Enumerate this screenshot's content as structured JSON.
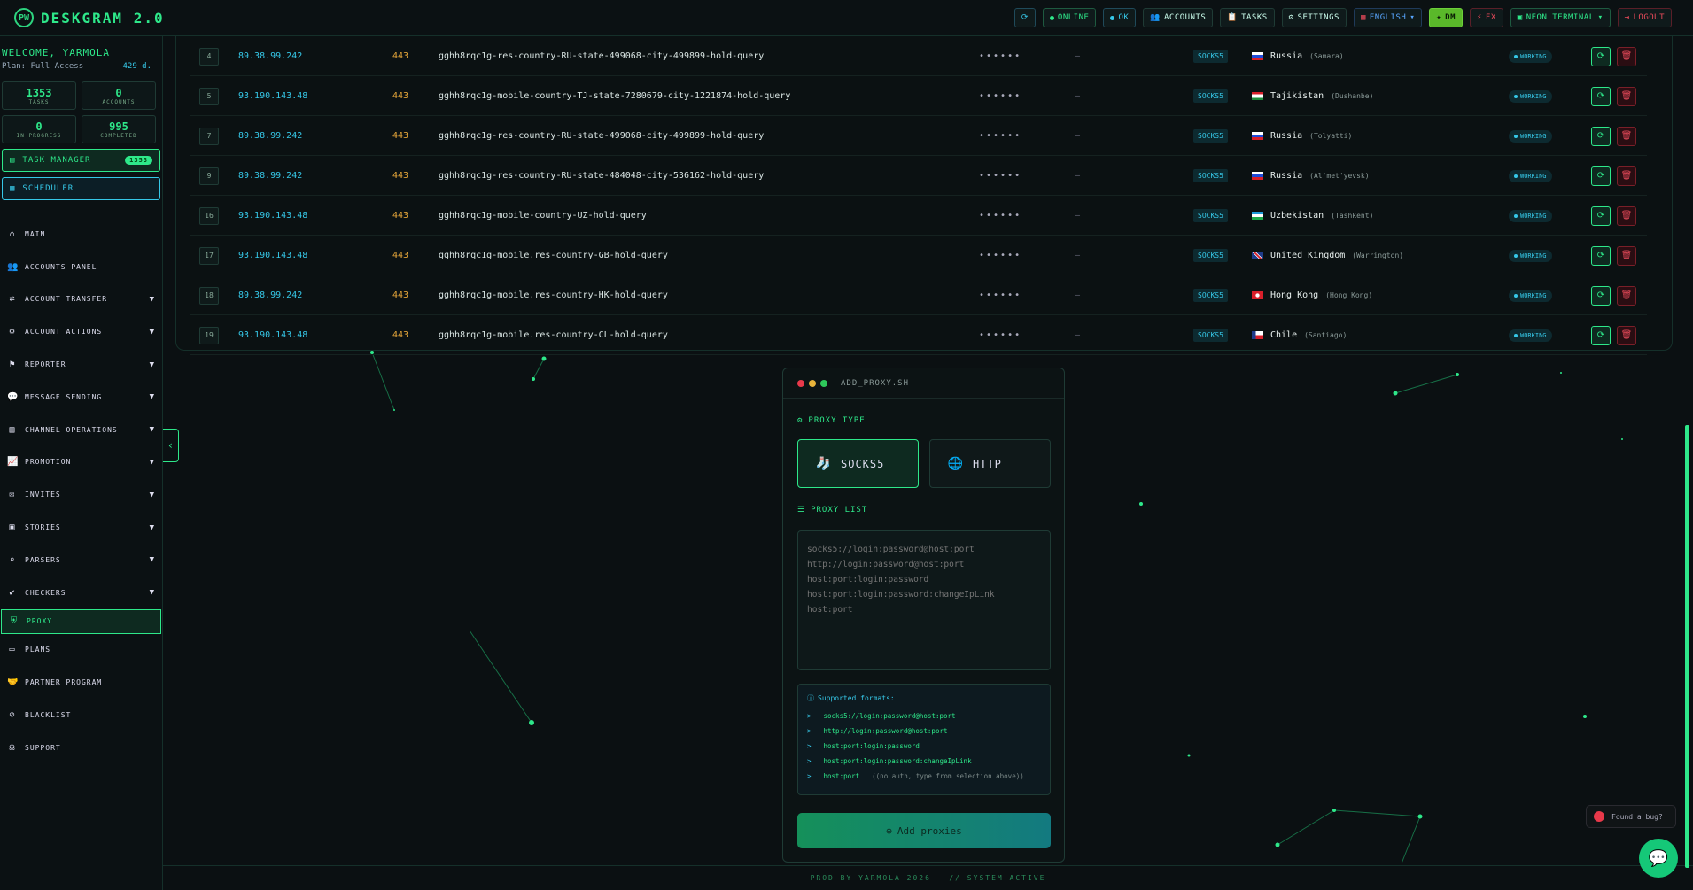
{
  "app": {
    "logo": "PW",
    "name": "DESKGRAM 2.0"
  },
  "topbar": {
    "refresh_icon": "refresh-icon",
    "online": "ONLINE",
    "ok": "OK",
    "accounts": "ACCOUNTS",
    "tasks": "TASKS",
    "settings": "SETTINGS",
    "language": "ENGLISH",
    "dm": "DM",
    "fx": "FX",
    "theme": "NEON TERMINAL",
    "logout": "LOGOUT"
  },
  "sidebar": {
    "welcome": "WELCOME, YARMOLA",
    "plan": "Plan: Full Access",
    "days": "429 d.",
    "stats": [
      {
        "value": "1353",
        "label": "TASKS"
      },
      {
        "value": "0",
        "label": "ACCOUNTS"
      },
      {
        "value": "0",
        "label": "IN PROGRESS"
      },
      {
        "value": "995",
        "label": "COMPLETED"
      }
    ],
    "task_manager": "TASK MANAGER",
    "task_manager_badge": "1353",
    "scheduler": "SCHEDULER",
    "menu": [
      {
        "label": "MAIN",
        "icon": "home-icon",
        "has_chevron": false
      },
      {
        "label": "ACCOUNTS PANEL",
        "icon": "users-icon",
        "has_chevron": false
      },
      {
        "label": "ACCOUNT TRANSFER",
        "icon": "transfer-icon",
        "has_chevron": true
      },
      {
        "label": "ACCOUNT ACTIONS",
        "icon": "user-cog-icon",
        "has_chevron": true
      },
      {
        "label": "REPORTER",
        "icon": "flag-icon",
        "has_chevron": true
      },
      {
        "label": "MESSAGE SENDING",
        "icon": "chat-icon",
        "has_chevron": true
      },
      {
        "label": "CHANNEL OPERATIONS",
        "icon": "channel-icon",
        "has_chevron": true
      },
      {
        "label": "PROMOTION",
        "icon": "chart-icon",
        "has_chevron": true
      },
      {
        "label": "INVITES",
        "icon": "invite-icon",
        "has_chevron": true
      },
      {
        "label": "STORIES",
        "icon": "stories-icon",
        "has_chevron": true
      },
      {
        "label": "PARSERS",
        "icon": "search-icon",
        "has_chevron": true
      },
      {
        "label": "CHECKERS",
        "icon": "check-icon",
        "has_chevron": true
      },
      {
        "label": "PROXY",
        "icon": "shield-icon",
        "has_chevron": false,
        "active": true
      },
      {
        "label": "PLANS",
        "icon": "card-icon",
        "has_chevron": false
      },
      {
        "label": "PARTNER PROGRAM",
        "icon": "partner-icon",
        "has_chevron": false
      },
      {
        "label": "BLACKLIST",
        "icon": "block-user-icon",
        "has_chevron": false
      },
      {
        "label": "SUPPORT",
        "icon": "headset-icon",
        "has_chevron": false
      }
    ]
  },
  "proxies": [
    {
      "id": "4",
      "ip": "89.38.99.242",
      "port": "443",
      "login": "gghh8rqc1g-res-country-RU-state-499068-city-499899-hold-query",
      "password": "••••••",
      "extra": "—",
      "type": "SOCKS5",
      "country": "Russia",
      "city": "(Samara)",
      "flag": "ru",
      "status": "WORKING"
    },
    {
      "id": "5",
      "ip": "93.190.143.48",
      "port": "443",
      "login": "gghh8rqc1g-mobile-country-TJ-state-7280679-city-1221874-hold-query",
      "password": "••••••",
      "extra": "—",
      "type": "SOCKS5",
      "country": "Tajikistan",
      "city": "(Dushanbe)",
      "flag": "tj",
      "status": "WORKING"
    },
    {
      "id": "7",
      "ip": "89.38.99.242",
      "port": "443",
      "login": "gghh8rqc1g-res-country-RU-state-499068-city-499899-hold-query",
      "password": "••••••",
      "extra": "—",
      "type": "SOCKS5",
      "country": "Russia",
      "city": "(Tolyatti)",
      "flag": "ru",
      "status": "WORKING"
    },
    {
      "id": "9",
      "ip": "89.38.99.242",
      "port": "443",
      "login": "gghh8rqc1g-res-country-RU-state-484048-city-536162-hold-query",
      "password": "••••••",
      "extra": "—",
      "type": "SOCKS5",
      "country": "Russia",
      "city": "(Al'met'yevsk)",
      "flag": "ru",
      "status": "WORKING"
    },
    {
      "id": "16",
      "ip": "93.190.143.48",
      "port": "443",
      "login": "gghh8rqc1g-mobile-country-UZ-hold-query",
      "password": "••••••",
      "extra": "—",
      "type": "SOCKS5",
      "country": "Uzbekistan",
      "city": "(Tashkent)",
      "flag": "uz",
      "status": "WORKING"
    },
    {
      "id": "17",
      "ip": "93.190.143.48",
      "port": "443",
      "login": "gghh8rqc1g-mobile.res-country-GB-hold-query",
      "password": "••••••",
      "extra": "—",
      "type": "SOCKS5",
      "country": "United Kingdom",
      "city": "(Warrington)",
      "flag": "gb",
      "status": "WORKING"
    },
    {
      "id": "18",
      "ip": "89.38.99.242",
      "port": "443",
      "login": "gghh8rqc1g-mobile.res-country-HK-hold-query",
      "password": "••••••",
      "extra": "—",
      "type": "SOCKS5",
      "country": "Hong Kong",
      "city": "(Hong Kong)",
      "flag": "hk",
      "status": "WORKING"
    },
    {
      "id": "19",
      "ip": "93.190.143.48",
      "port": "443",
      "login": "gghh8rqc1g-mobile.res-country-CL-hold-query",
      "password": "••••••",
      "extra": "—",
      "type": "SOCKS5",
      "country": "Chile",
      "city": "(Santiago)",
      "flag": "cl",
      "status": "WORKING"
    }
  ],
  "add_proxy": {
    "title": "ADD_PROXY.SH",
    "type_label": "PROXY TYPE",
    "types": [
      {
        "label": "SOCKS5",
        "icon": "socks-icon",
        "selected": true
      },
      {
        "label": "HTTP",
        "icon": "globe-icon",
        "selected": false
      }
    ],
    "list_label": "PROXY LIST",
    "placeholder": "socks5://login:password@host:port\nhttp://login:password@host:port\nhost:port:login:password\nhost:port:login:password:changeIpLink\nhost:port",
    "formats_title": "Supported formats:",
    "formats": [
      {
        "text": "socks5://login:password@host:port",
        "note": ""
      },
      {
        "text": "http://login:password@host:port",
        "note": ""
      },
      {
        "text": "host:port:login:password",
        "note": ""
      },
      {
        "text": "host:port:login:password:changeIpLink",
        "note": ""
      },
      {
        "text": "host:port",
        "note": "((no auth, type from selection above))"
      }
    ],
    "submit": "Add proxies"
  },
  "footer": {
    "text": "PROD BY YARMOLA 2026   // SYSTEM ACTIVE"
  },
  "bug_button": "Found a bug?",
  "colors": {
    "accent": "#2ee88a",
    "cyan": "#36c8e8",
    "danger": "#e84a5a",
    "port": "#e8a83a"
  }
}
